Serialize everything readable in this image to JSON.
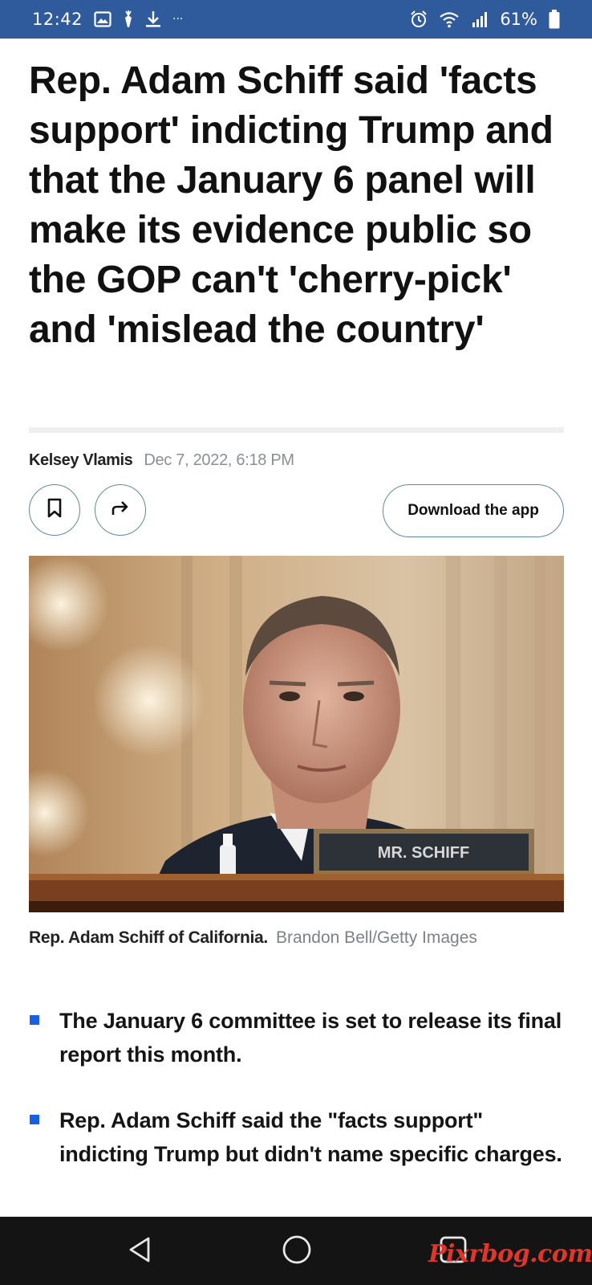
{
  "status_bar": {
    "time": "12:42",
    "battery": "61%",
    "left_icons": [
      "gallery-icon",
      "carrot-icon",
      "download-icon",
      "more-dots-icon"
    ],
    "right_icons": [
      "alarm-icon",
      "wifi-icon",
      "signal-icon",
      "battery-icon"
    ],
    "more": "···"
  },
  "article": {
    "headline": "Rep. Adam Schiff said 'facts support' indicting Trump and that the January 6 panel will make its evidence public so the GOP can't 'cherry-pick' and 'mislead the country'",
    "author": "Kelsey Vlamis",
    "date": "Dec 7, 2022, 6:18 PM",
    "download_label": "Download the app",
    "nameplate": "MR. SCHIFF",
    "caption": "Rep. Adam Schiff of California.",
    "credit": "Brandon Bell/Getty Images",
    "bullets": [
      "The January 6 committee is set to release its final report this month.",
      "Rep. Adam Schiff said the \"facts support\" indicting Trump but didn't name specific charges."
    ],
    "accent_color": "#1a5fe0"
  },
  "nav_bar": {
    "buttons": [
      "back-icon",
      "home-icon",
      "recents-icon"
    ]
  },
  "watermark": "Pixrbog.com",
  "colors": {
    "status_bar": "#2f5a9c",
    "nav_bar": "#141414",
    "button_border": "#5e8a99",
    "date_text": "#8a8f96",
    "watermark": "#e0352b"
  }
}
